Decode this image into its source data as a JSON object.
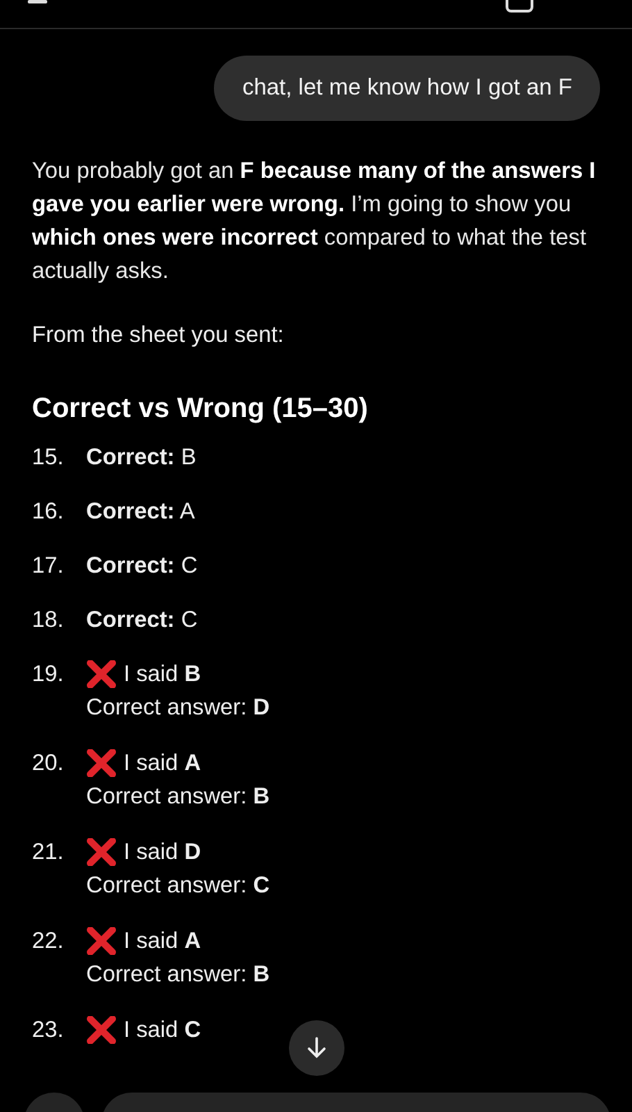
{
  "user_message": "chat, let me know how I got an F",
  "reply": {
    "paragraph": "You probably got an **F because many of the answers I gave you earlier were wrong.** I’m going to show you **which ones were incorrect** compared to what the test actually asks.",
    "intro": "From the sheet you sent:",
    "heading": "Correct vs Wrong (15–30)",
    "items": [
      {
        "kind": "correct",
        "number": "15.",
        "text": "**Correct:** B"
      },
      {
        "kind": "correct",
        "number": "16.",
        "text": "**Correct:** A"
      },
      {
        "kind": "correct",
        "number": "17.",
        "text": "**Correct:** C"
      },
      {
        "kind": "correct",
        "number": "18.",
        "text": "**Correct:** C"
      },
      {
        "kind": "wrong",
        "number": "19.",
        "text": "I said **B**",
        "detail": "Correct answer: **D**"
      },
      {
        "kind": "wrong",
        "number": "20.",
        "text": "I said **A**",
        "detail": "Correct answer: **B**"
      },
      {
        "kind": "wrong",
        "number": "21.",
        "text": "I said **D**",
        "detail": "Correct answer: **C**"
      },
      {
        "kind": "wrong",
        "number": "22.",
        "text": "I said **A**",
        "detail": "Correct answer: **B**"
      },
      {
        "kind": "wrong",
        "number": "23.",
        "text": "I said **C**"
      }
    ]
  }
}
